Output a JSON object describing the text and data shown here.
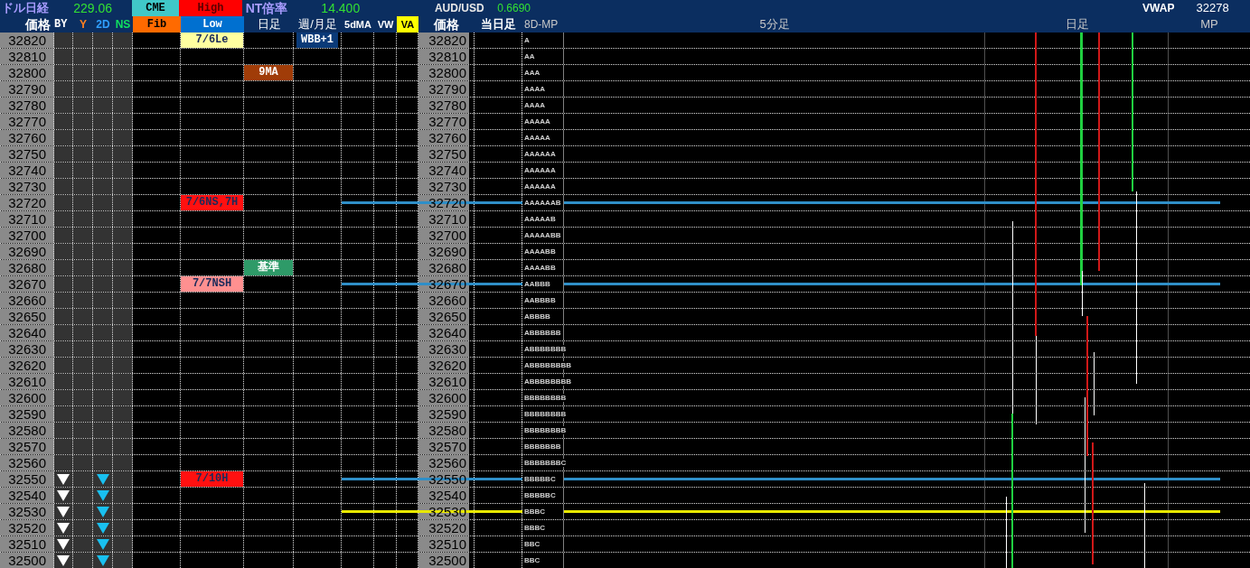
{
  "header": {
    "title": "ドル日経",
    "title_value": "229.06",
    "cme": "CME",
    "high": "High",
    "nt_label": "NT倍率",
    "nt_value": "14.400",
    "fx_label": "AUD/USD",
    "fx_value": "0.6690",
    "vwap_label": "VWAP",
    "vwap_value": "32278"
  },
  "columns": [
    "価格",
    "BY",
    "Y",
    "2D",
    "NS",
    "Fib",
    "Low",
    "日足",
    "週/月足",
    "5dMA",
    "VW",
    "VA",
    "価格",
    "当日足",
    "8D-MP",
    "5分足",
    "日足",
    "MP"
  ],
  "rows": [
    {
      "price": "32820",
      "price_2": "32820",
      "by": false,
      "two_d": false,
      "tpo": "A",
      "high_low": {
        "text": "7/6Le",
        "color": "#ffffa0"
      },
      "weekly": {
        "text": "WBB+1",
        "color": "#0a3a78"
      }
    },
    {
      "price": "32810",
      "price_2": "32810",
      "by": false,
      "two_d": false,
      "tpo": "AA"
    },
    {
      "price": "32800",
      "price_2": "32800",
      "by": false,
      "two_d": false,
      "tpo": "AAA",
      "daily": {
        "text": "9MA",
        "color": "#a03c08"
      }
    },
    {
      "price": "32790",
      "price_2": "32790",
      "by": false,
      "two_d": false,
      "tpo": "AAAA"
    },
    {
      "price": "32780",
      "price_2": "32780",
      "by": false,
      "two_d": false,
      "tpo": "AAAA"
    },
    {
      "price": "32770",
      "price_2": "32770",
      "by": false,
      "two_d": false,
      "tpo": "AAAAA"
    },
    {
      "price": "32760",
      "price_2": "32760",
      "by": false,
      "two_d": false,
      "tpo": "AAAAA"
    },
    {
      "price": "32750",
      "price_2": "32750",
      "by": false,
      "two_d": false,
      "tpo": "AAAAAA"
    },
    {
      "price": "32740",
      "price_2": "32740",
      "by": false,
      "two_d": false,
      "tpo": "AAAAAA"
    },
    {
      "price": "32730",
      "price_2": "32730",
      "by": false,
      "two_d": false,
      "tpo": "AAAAAA"
    },
    {
      "price": "32720",
      "price_2": "32720",
      "by": false,
      "two_d": false,
      "tpo": "AAAAAAB",
      "high_low": {
        "text": "7/6NS,7H",
        "color": "#ff1010"
      },
      "line": {
        "color": "#2f8fc8"
      }
    },
    {
      "price": "32710",
      "price_2": "32710",
      "by": false,
      "two_d": false,
      "tpo": "AAAAAB"
    },
    {
      "price": "32700",
      "price_2": "32700",
      "by": false,
      "two_d": false,
      "tpo": "AAAAABB"
    },
    {
      "price": "32690",
      "price_2": "32690",
      "by": false,
      "two_d": false,
      "tpo": "AAAABB"
    },
    {
      "price": "32680",
      "price_2": "32680",
      "by": false,
      "two_d": false,
      "tpo": "AAAABB",
      "daily": {
        "text": "基準",
        "color": "#2e9a68"
      }
    },
    {
      "price": "32670",
      "price_2": "32670",
      "by": false,
      "two_d": false,
      "tpo": "AABBB",
      "high_low": {
        "text": "7/7NSH",
        "color": "#ff9090"
      },
      "line": {
        "color": "#2f8fc8"
      }
    },
    {
      "price": "32660",
      "price_2": "32660",
      "by": false,
      "two_d": false,
      "tpo": "AABBBB"
    },
    {
      "price": "32650",
      "price_2": "32650",
      "by": false,
      "two_d": false,
      "tpo": "ABBBB"
    },
    {
      "price": "32640",
      "price_2": "32640",
      "by": false,
      "two_d": false,
      "tpo": "ABBBBBB"
    },
    {
      "price": "32630",
      "price_2": "32630",
      "by": false,
      "two_d": false,
      "tpo": "ABBBBBBB"
    },
    {
      "price": "32620",
      "price_2": "32620",
      "by": false,
      "two_d": false,
      "tpo": "ABBBBBBBB"
    },
    {
      "price": "32610",
      "price_2": "32610",
      "by": false,
      "two_d": false,
      "tpo": "ABBBBBBBB"
    },
    {
      "price": "32600",
      "price_2": "32600",
      "by": false,
      "two_d": false,
      "tpo": "BBBBBBBB"
    },
    {
      "price": "32590",
      "price_2": "32590",
      "by": false,
      "two_d": false,
      "tpo": "BBBBBBBB"
    },
    {
      "price": "32580",
      "price_2": "32580",
      "by": false,
      "two_d": false,
      "tpo": "BBBBBBBB"
    },
    {
      "price": "32570",
      "price_2": "32570",
      "by": false,
      "two_d": false,
      "tpo": "BBBBBBB"
    },
    {
      "price": "32560",
      "price_2": "32560",
      "by": false,
      "two_d": false,
      "tpo": "BBBBBBBC"
    },
    {
      "price": "32550",
      "price_2": "32550",
      "by": true,
      "two_d": true,
      "tpo": "BBBBBC",
      "high_low": {
        "text": "7/10H",
        "color": "#ff1010"
      },
      "line": {
        "color": "#2f8fc8"
      }
    },
    {
      "price": "32540",
      "price_2": "32540",
      "by": true,
      "two_d": true,
      "tpo": "BBBBBC"
    },
    {
      "price": "32530",
      "price_2": "32530",
      "by": true,
      "two_d": true,
      "tpo": "BBBC",
      "line": {
        "color": "#e8e800"
      }
    },
    {
      "price": "32520",
      "price_2": "32520",
      "by": true,
      "two_d": true,
      "tpo": "BBBC"
    },
    {
      "price": "32510",
      "price_2": "32510",
      "by": true,
      "two_d": true,
      "tpo": "BBC"
    },
    {
      "price": "32500",
      "price_2": "32500",
      "by": true,
      "two_d": true,
      "tpo": "BBC"
    }
  ]
}
